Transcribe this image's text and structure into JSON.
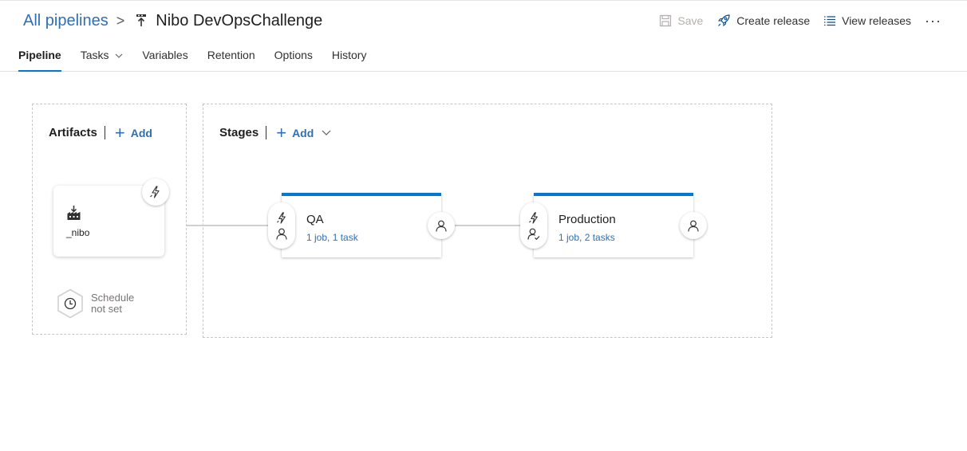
{
  "breadcrumb": {
    "root": "All pipelines",
    "separator": ">",
    "pipeline_icon": "release-pipeline-icon",
    "title": "Nibo DevOpsChallenge"
  },
  "toolbar": {
    "save": "Save",
    "create_release": "Create release",
    "view_releases": "View releases",
    "more": "···"
  },
  "tabs": [
    {
      "label": "Pipeline",
      "active": true
    },
    {
      "label": "Tasks",
      "dropdown": true
    },
    {
      "label": "Variables"
    },
    {
      "label": "Retention"
    },
    {
      "label": "Options"
    },
    {
      "label": "History"
    }
  ],
  "artifacts": {
    "heading": "Artifacts",
    "add_label": "Add",
    "items": [
      {
        "name": "_nibo",
        "icon": "build-artifact-icon"
      }
    ]
  },
  "schedule": {
    "line1": "Schedule",
    "line2": "not set"
  },
  "stages": {
    "heading": "Stages",
    "add_label": "Add",
    "items": [
      {
        "name": "QA",
        "summary": "1 job, 1 task"
      },
      {
        "name": "Production",
        "summary": "1 job, 2 tasks"
      }
    ]
  },
  "colors": {
    "accent": "#0078d4",
    "link": "#2f6fb5",
    "disabled": "#b3b0ad"
  }
}
